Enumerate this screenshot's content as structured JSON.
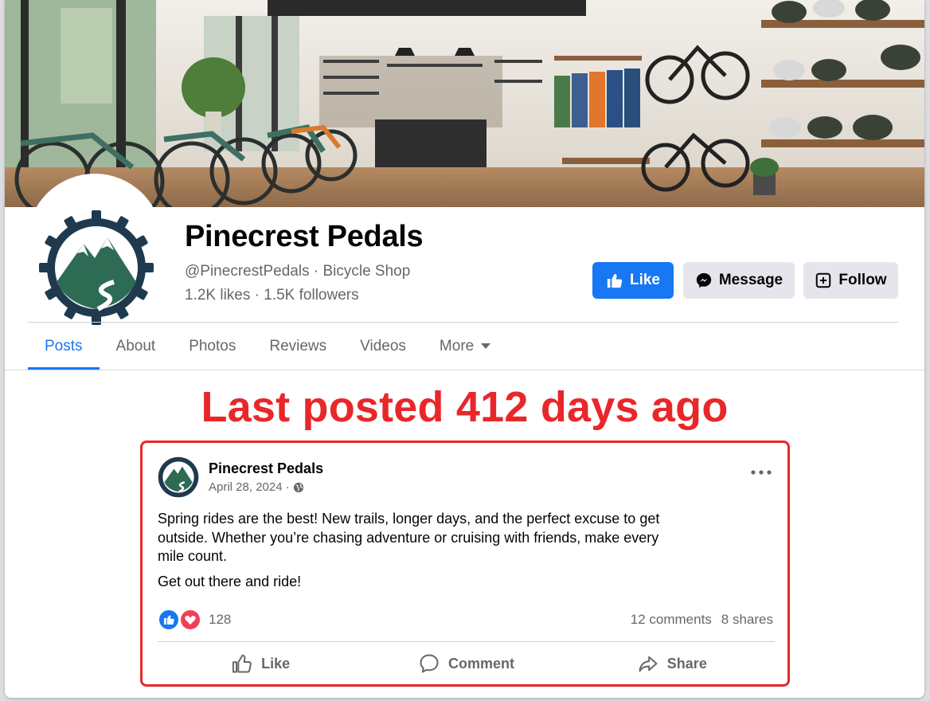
{
  "page": {
    "name": "Pinecrest Pedals",
    "handle": "@PinecrestPedals · Bicycle Shop",
    "stats": "1.2K likes · 1.5K followers"
  },
  "buttons": {
    "like": "Like",
    "message": "Message",
    "follow": "Follow"
  },
  "tabs": [
    {
      "label": "Posts",
      "active": true
    },
    {
      "label": "About"
    },
    {
      "label": "Photos"
    },
    {
      "label": "Reviews"
    },
    {
      "label": "Videos"
    },
    {
      "label": "More"
    }
  ],
  "banner": "Last posted 412 days ago",
  "post": {
    "author": "Pinecrest Pedals",
    "date": "April 28, 2024",
    "separator": "·",
    "privacy_icon": "globe-icon",
    "body": "Spring rides are the best! New trails, longer days, and the perfect excuse to get outside. Whether you’re chasing adventure or cruising with friends, make every mile count.",
    "body2": "Get out there and ride!",
    "reaction_count": "128",
    "comments": "12 comments",
    "shares": "8 shares",
    "actions": {
      "like": "Like",
      "comment": "Comment",
      "share": "Share"
    }
  },
  "colors": {
    "brand_blue": "#1877f2",
    "alert_red": "#e8272a",
    "muted": "#65676b",
    "logo_green": "#2e6b55",
    "logo_navy": "#1f3a4f"
  }
}
